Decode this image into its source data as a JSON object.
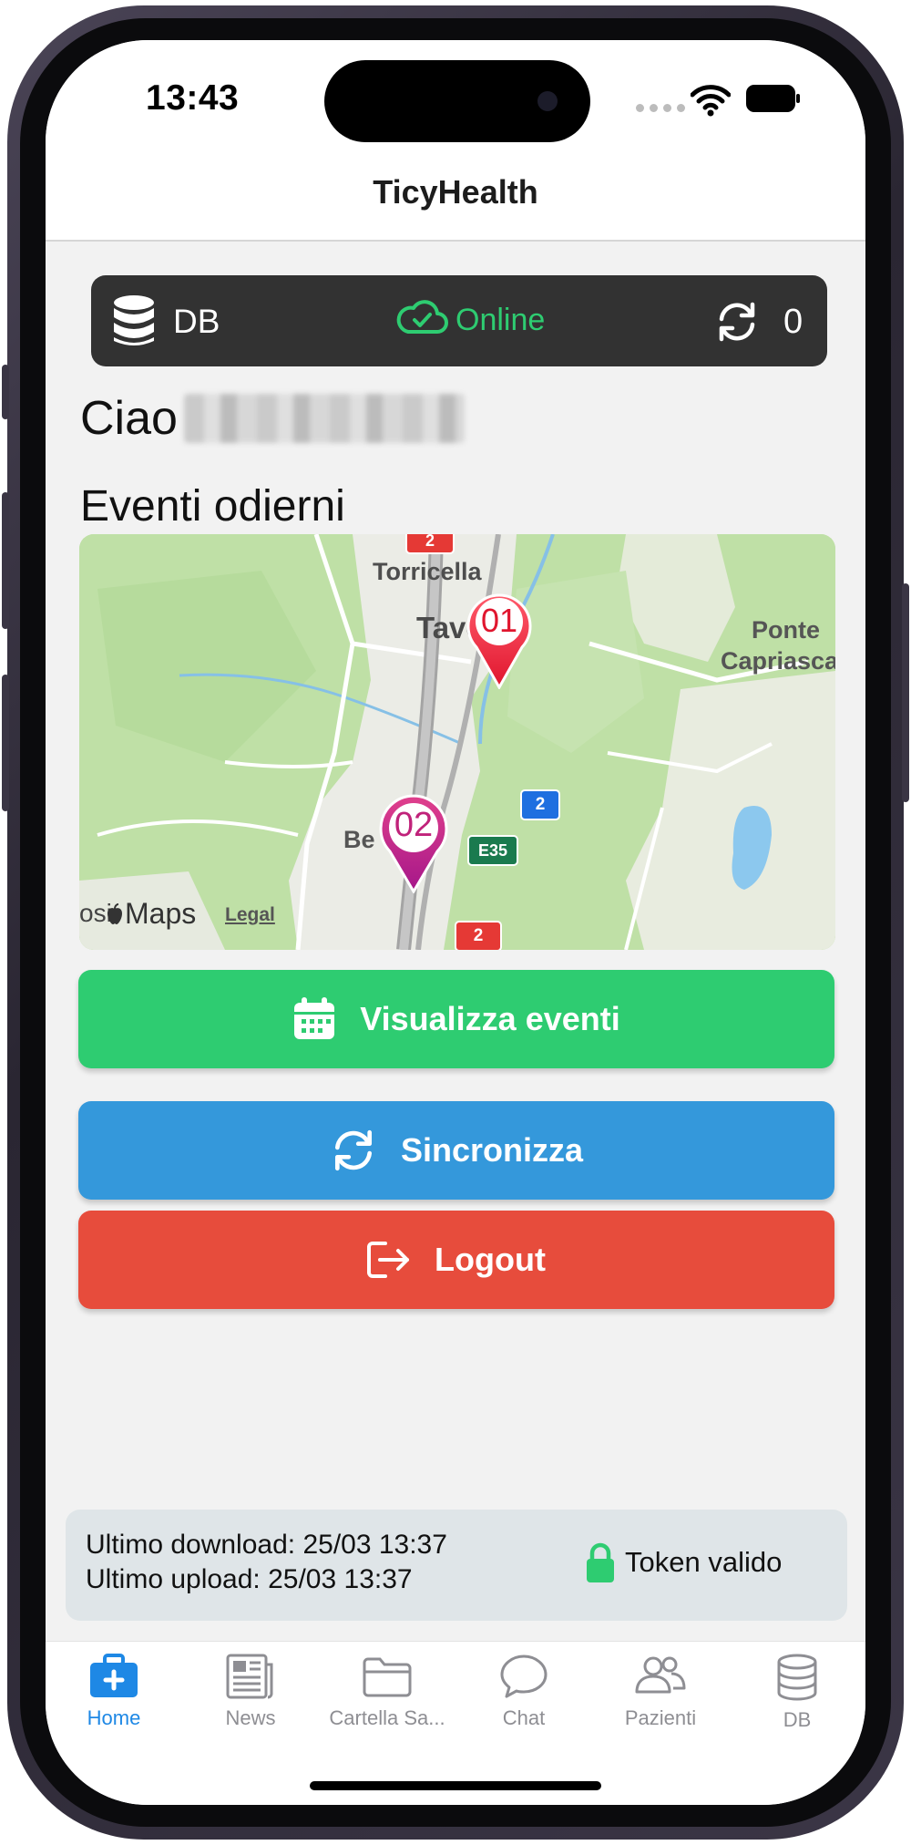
{
  "status_bar": {
    "time": "13:43"
  },
  "nav": {
    "title": "TicyHealth"
  },
  "db_status": {
    "db_label": "DB",
    "online_label": "Online",
    "sync_count": "0"
  },
  "greeting": {
    "prefix": "Ciao"
  },
  "events": {
    "section_title": "Eventi odierni",
    "map": {
      "places": [
        "Torricella",
        "Taverne",
        "Ponte",
        "Capriasca",
        "Be"
      ],
      "markers": [
        "01",
        "02"
      ],
      "road_shields": [
        "2",
        "2",
        "E35",
        "2",
        "2"
      ],
      "attribution": "Maps",
      "attribution_prefix": "osi",
      "legal": "Legal"
    }
  },
  "actions": {
    "view_events": "Visualizza eventi",
    "sync": "Sincronizza",
    "logout": "Logout"
  },
  "info": {
    "last_download": "Ultimo download: 25/03 13:37",
    "last_upload": "Ultimo upload: 25/03 13:37",
    "token": "Token valido"
  },
  "tabs": [
    {
      "label": "Home",
      "icon": "medical-kit-icon",
      "active": true
    },
    {
      "label": "News",
      "icon": "newspaper-icon",
      "active": false
    },
    {
      "label": "Cartella Sa...",
      "icon": "folder-icon",
      "active": false
    },
    {
      "label": "Chat",
      "icon": "chat-bubble-icon",
      "active": false
    },
    {
      "label": "Pazienti",
      "icon": "users-icon",
      "active": false
    },
    {
      "label": "DB",
      "icon": "database-icon",
      "active": false
    }
  ],
  "colors": {
    "green": "#2ecc71",
    "blue": "#3498db",
    "red": "#e74c3c",
    "active_tab": "#1e88e5",
    "db_bar": "#323232"
  }
}
